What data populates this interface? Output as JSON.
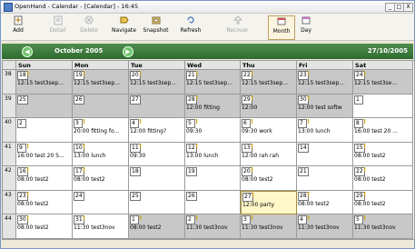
{
  "window": {
    "title": "OpenHand - Calendar - [Calendar] - 16:45",
    "controls": [
      "_",
      "□",
      "X"
    ]
  },
  "toolbar": {
    "buttons": [
      {
        "label": "Add",
        "icon": "add-icon"
      },
      {
        "label": "Detail",
        "icon": "detail-icon",
        "disabled": true
      },
      {
        "label": "Delete",
        "icon": "delete-icon",
        "disabled": true
      },
      {
        "label": "Navigate",
        "icon": "navigate-icon"
      },
      {
        "label": "Snapshot",
        "icon": "snapshot-icon"
      },
      {
        "label": "Refresh",
        "icon": "refresh-icon"
      },
      {
        "label": "Recover",
        "icon": "recover-icon",
        "disabled": true
      },
      {
        "label": "Month",
        "icon": "month-icon",
        "pressed": true
      },
      {
        "label": "Day",
        "icon": "day-icon"
      }
    ]
  },
  "nav": {
    "prev": "◀",
    "month_label": "October 2005",
    "next": "▶",
    "current_date": "27/10/2005"
  },
  "calendar": {
    "days": [
      "Sun",
      "Mon",
      "Tue",
      "Wed",
      "Thu",
      "Fri",
      "Sat"
    ],
    "weeks": [
      {
        "week": "38",
        "days": [
          {
            "day": "18",
            "event": "12:15 test3sep...",
            "shaded": true,
            "alert": true
          },
          {
            "day": "19",
            "event": "12:15 test3sep...",
            "shaded": true,
            "alert": true
          },
          {
            "day": "20",
            "event": "12:15 test3sep...",
            "shaded": true,
            "alert": true
          },
          {
            "day": "21",
            "event": "12:15 test3sep...",
            "shaded": true,
            "alert": true
          },
          {
            "day": "22",
            "event": "12:15 test3sep...",
            "shaded": true,
            "alert": true
          },
          {
            "day": "23",
            "event": "12:15 test3sep...",
            "shaded": true,
            "alert": true
          },
          {
            "day": "24",
            "event": "12:15 test3se...",
            "shaded": true,
            "alert": true
          }
        ]
      },
      {
        "week": "39",
        "days": [
          {
            "day": "25",
            "event": "",
            "shaded": true,
            "alert": false
          },
          {
            "day": "26",
            "event": "",
            "shaded": true,
            "alert": false
          },
          {
            "day": "27",
            "event": "",
            "shaded": true,
            "alert": false
          },
          {
            "day": "28",
            "event": "12:00 fitting",
            "shaded": true,
            "alert": true
          },
          {
            "day": "29",
            "event": "12:00",
            "shaded": true,
            "alert": true
          },
          {
            "day": "30",
            "event": "12:00 test softw",
            "shaded": true,
            "alert": true
          },
          {
            "day": "1",
            "event": "",
            "shaded": false,
            "alert": false
          }
        ]
      },
      {
        "week": "40",
        "days": [
          {
            "day": "2",
            "event": "",
            "shaded": false,
            "alert": false
          },
          {
            "day": "3",
            "event": "20:00 fitting fo...",
            "shaded": false,
            "alert": true
          },
          {
            "day": "4",
            "event": "12:00 fitting?",
            "shaded": false,
            "alert": true
          },
          {
            "day": "5",
            "event": "09:30",
            "shaded": false,
            "alert": true
          },
          {
            "day": "6",
            "event": "09:30 work",
            "shaded": false,
            "alert": true
          },
          {
            "day": "7",
            "event": "13:00 lunch",
            "shaded": false,
            "alert": true
          },
          {
            "day": "8",
            "event": "16:00 test 20 ...",
            "shaded": false,
            "alert": true
          }
        ]
      },
      {
        "week": "41",
        "days": [
          {
            "day": "9",
            "event": "16:00 test 20 S...",
            "shaded": false,
            "alert": true
          },
          {
            "day": "10",
            "event": "13:00 lunch",
            "shaded": false,
            "alert": true
          },
          {
            "day": "11",
            "event": "09:30",
            "shaded": false,
            "alert": true
          },
          {
            "day": "12",
            "event": "13:00 lunch",
            "shaded": false,
            "alert": true
          },
          {
            "day": "13",
            "event": "12:00 rah rah",
            "shaded": false,
            "alert": true
          },
          {
            "day": "14",
            "event": "",
            "shaded": false,
            "alert": false
          },
          {
            "day": "15",
            "event": "08:00 test2",
            "shaded": false,
            "alert": true
          }
        ]
      },
      {
        "week": "42",
        "days": [
          {
            "day": "16",
            "event": "08:00 test2",
            "shaded": false,
            "alert": true
          },
          {
            "day": "17",
            "event": "08:00 test2",
            "shaded": false,
            "alert": true
          },
          {
            "day": "18",
            "event": "",
            "shaded": false,
            "alert": false
          },
          {
            "day": "19",
            "event": "",
            "shaded": false,
            "alert": false
          },
          {
            "day": "20",
            "event": "08:00 test2",
            "shaded": false,
            "alert": true
          },
          {
            "day": "21",
            "event": "",
            "shaded": false,
            "alert": false
          },
          {
            "day": "22",
            "event": "08:00 test2",
            "shaded": false,
            "alert": true
          }
        ]
      },
      {
        "week": "43",
        "days": [
          {
            "day": "23",
            "event": "08:00 test2",
            "shaded": false,
            "alert": true
          },
          {
            "day": "24",
            "event": "",
            "shaded": false,
            "alert": false
          },
          {
            "day": "25",
            "event": "",
            "shaded": false,
            "alert": false
          },
          {
            "day": "26",
            "event": "",
            "shaded": false,
            "alert": false
          },
          {
            "day": "27",
            "event": "12:00 party",
            "shaded": false,
            "alert": true,
            "today": true
          },
          {
            "day": "28",
            "event": "08:00 test2",
            "shaded": false,
            "alert": true
          },
          {
            "day": "29",
            "event": "08:00 test2",
            "shaded": false,
            "alert": true
          }
        ]
      },
      {
        "week": "44",
        "days": [
          {
            "day": "30",
            "event": "08:00 test2",
            "shaded": false,
            "alert": true
          },
          {
            "day": "31",
            "event": "11:30 test3nov",
            "shaded": false,
            "alert": true
          },
          {
            "day": "1",
            "event": "08:00 test2",
            "shaded": true,
            "alert": true
          },
          {
            "day": "2",
            "event": "11:30 test3nov",
            "shaded": true,
            "alert": true
          },
          {
            "day": "3",
            "event": "11:30 test3nov",
            "shaded": true,
            "alert": true
          },
          {
            "day": "4",
            "event": "11:30 test3nov",
            "shaded": true,
            "alert": true
          },
          {
            "day": "5",
            "event": "11:30 test3nov",
            "shaded": true,
            "alert": true
          }
        ]
      }
    ]
  }
}
